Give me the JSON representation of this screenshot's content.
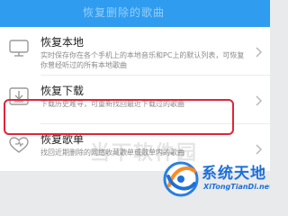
{
  "header": {
    "title": "恢复删除的歌曲"
  },
  "menu": {
    "items": [
      {
        "title": "恢复本地",
        "description": "实时保存你在各个手机上的本地音乐和PC上的默认列表，可恢复你曾经听过的所有本地歌曲",
        "icon": "monitor-icon"
      },
      {
        "title": "恢复下载",
        "description": "下载历史难寻，可重新找回最近下载过的歌曲",
        "icon": "download-icon"
      },
      {
        "title": "恢复歌单",
        "description": "找回近期删除的网络收藏歌单或歌单内的歌曲",
        "icon": "heart-icon"
      }
    ]
  },
  "watermark": {
    "text": "当下软件园",
    "logo_cn": "系统天地",
    "logo_en": "XiTongTianDi.net"
  },
  "colors": {
    "accent": "#2f9cf0",
    "highlight": "#e0243a",
    "logo": "#1e6fd8"
  }
}
